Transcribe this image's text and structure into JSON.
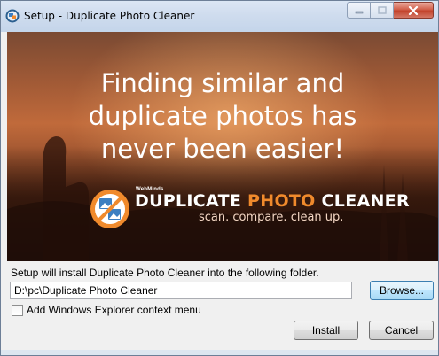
{
  "window": {
    "title": "Setup - Duplicate Photo Cleaner"
  },
  "banner": {
    "headline_line1": "Finding similar and",
    "headline_line2": "duplicate photos has",
    "headline_line3": "never been easier!",
    "brand_small": "WebMinds",
    "brand_name_part1": "DUPLICATE ",
    "brand_name_part2": "PHOTO",
    "brand_name_part3": " CLEANER",
    "tagline": "scan. compare. clean up."
  },
  "form": {
    "install_label": "Setup will install Duplicate Photo Cleaner into the following folder.",
    "path_value": "D:\\pc\\Duplicate Photo Cleaner",
    "browse_label": "Browse...",
    "checkbox_label": "Add Windows Explorer context menu",
    "checkbox_checked": false
  },
  "buttons": {
    "install_label": "Install",
    "cancel_label": "Cancel"
  },
  "colors": {
    "brand_accent": "#f08a2c",
    "close_button": "#c2432c"
  },
  "icons": {
    "app": "duplicate-photo-cleaner-icon",
    "minimize": "minimize-icon",
    "maximize": "maximize-icon",
    "close": "close-icon"
  }
}
